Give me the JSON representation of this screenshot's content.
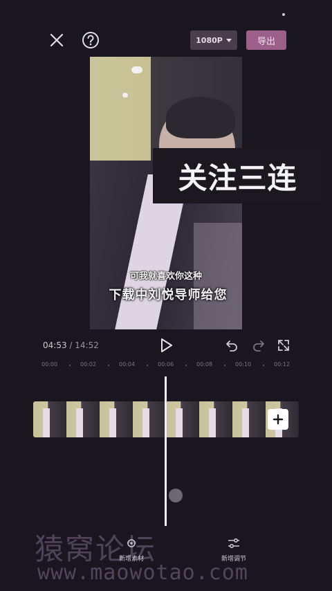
{
  "header": {
    "resolution_label": "1080P",
    "export_label": "导出",
    "close_icon": "close-icon",
    "help_icon": "help-icon"
  },
  "preview": {
    "overlay_title": "关注三连",
    "subtitle_line1": "可我就喜欢你这种",
    "subtitle_line2": "下载中刘悦导师给您"
  },
  "playback": {
    "current_time": "04:53",
    "separator": " / ",
    "total_time": "14:52"
  },
  "ruler": {
    "labels": [
      "00:00",
      "00:02",
      "00:04",
      "00:06",
      "00:08",
      "00:10",
      "00:12"
    ]
  },
  "tools": {
    "left_label": "新增素材",
    "right_label": "新增调节"
  },
  "watermark": {
    "line1": "猿窝论坛",
    "line2": "www.maowotao.com"
  },
  "colors": {
    "background": "#1a1620",
    "export_button": "#9c5f8a",
    "resolution_button": "#4a3e4c"
  }
}
